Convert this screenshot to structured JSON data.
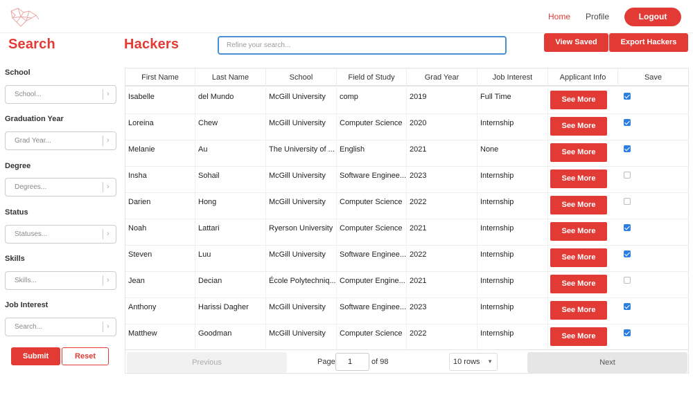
{
  "nav": {
    "home": "Home",
    "profile": "Profile",
    "logout": "Logout"
  },
  "headings": {
    "search": "Search",
    "hackers": "Hackers"
  },
  "search": {
    "placeholder": "Refine your search..."
  },
  "actions": {
    "view_saved": "View Saved",
    "export": "Export Hackers"
  },
  "filters": [
    {
      "label": "School",
      "placeholder": "School..."
    },
    {
      "label": "Graduation Year",
      "placeholder": "Grad Year..."
    },
    {
      "label": "Degree",
      "placeholder": "Degrees..."
    },
    {
      "label": "Status",
      "placeholder": "Statuses..."
    },
    {
      "label": "Skills",
      "placeholder": "Skills..."
    },
    {
      "label": "Job Interest",
      "placeholder": "Search..."
    }
  ],
  "filter_buttons": {
    "submit": "Submit",
    "reset": "Reset"
  },
  "table": {
    "columns": [
      "First Name",
      "Last Name",
      "School",
      "Field of Study",
      "Grad Year",
      "Job Interest",
      "Applicant Info",
      "Save"
    ],
    "see_more_label": "See More",
    "rows": [
      {
        "first": "Isabelle",
        "last": "del Mundo",
        "school": "McGill University",
        "field": "comp",
        "year": "2019",
        "interest": "Full Time",
        "saved": true
      },
      {
        "first": "Loreina",
        "last": "Chew",
        "school": "McGill University",
        "field": "Computer Science",
        "year": "2020",
        "interest": "Internship",
        "saved": true
      },
      {
        "first": "Melanie",
        "last": "Au",
        "school": "The University of ...",
        "field": "English",
        "year": "2021",
        "interest": "None",
        "saved": true
      },
      {
        "first": "Insha",
        "last": "Sohail",
        "school": "McGill University",
        "field": "Software Enginee...",
        "year": "2023",
        "interest": "Internship",
        "saved": false
      },
      {
        "first": "Darien",
        "last": "Hong",
        "school": "McGill University",
        "field": "Computer Science",
        "year": "2022",
        "interest": "Internship",
        "saved": false
      },
      {
        "first": "Noah",
        "last": "Lattari",
        "school": "Ryerson University",
        "field": "Computer Science",
        "year": "2021",
        "interest": "Internship",
        "saved": true
      },
      {
        "first": "Steven",
        "last": "Luu",
        "school": "McGill University",
        "field": "Software Enginee...",
        "year": "2022",
        "interest": "Internship",
        "saved": true
      },
      {
        "first": "Jean",
        "last": "Decian",
        "school": "École Polytechniq...",
        "field": "Computer Engine...",
        "year": "2021",
        "interest": "Internship",
        "saved": false
      },
      {
        "first": "Anthony",
        "last": "Harissi Dagher",
        "school": "McGill University",
        "field": "Software Enginee...",
        "year": "2023",
        "interest": "Internship",
        "saved": true
      },
      {
        "first": "Matthew",
        "last": "Goodman",
        "school": "McGill University",
        "field": "Computer Science",
        "year": "2022",
        "interest": "Internship",
        "saved": true
      }
    ]
  },
  "pagination": {
    "previous": "Previous",
    "next": "Next",
    "page_label": "Page",
    "current_page": "1",
    "of_label": "of 98",
    "rows_per_page": "10 rows"
  },
  "colors": {
    "accent": "#e23a35",
    "focus": "#4a8fd6",
    "checkbox": "#2f7fe0"
  }
}
